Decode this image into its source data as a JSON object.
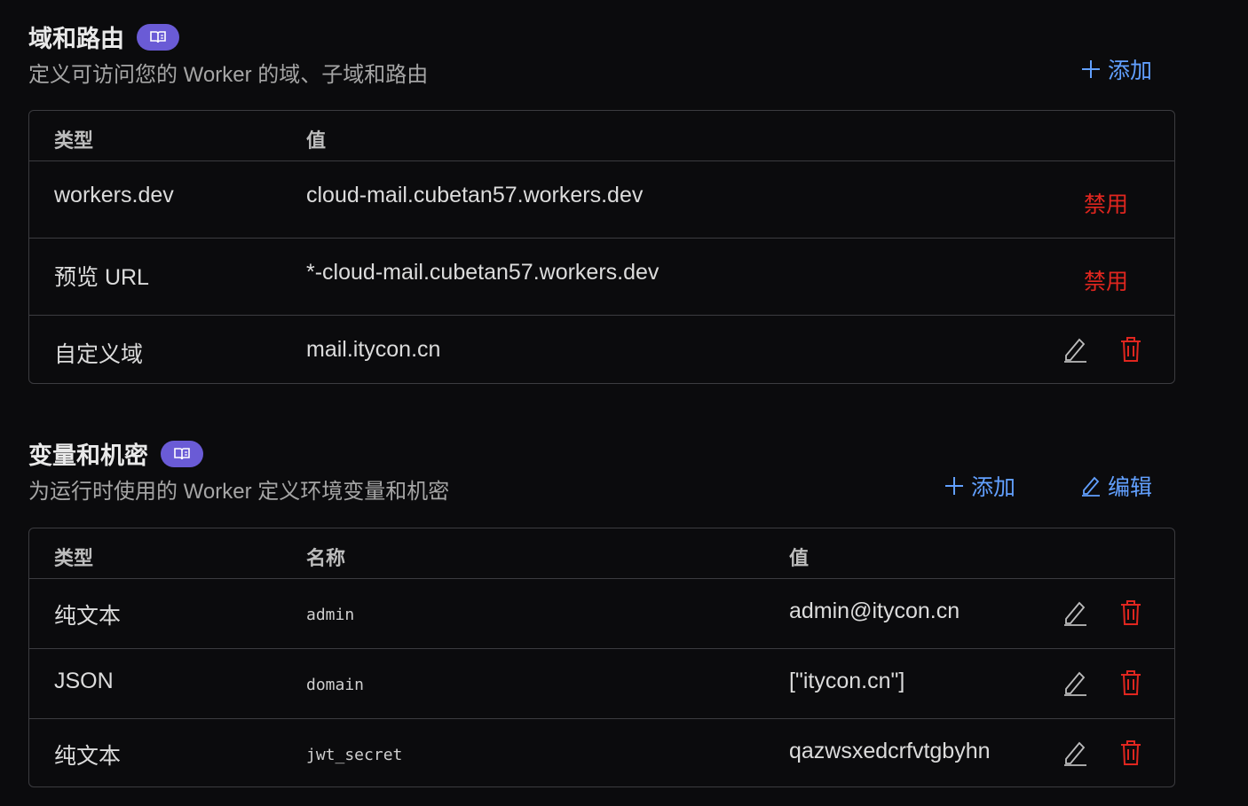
{
  "domains": {
    "title": "域和路由",
    "description": "定义可访问您的 Worker 的域、子域和路由",
    "add_label": "添加",
    "headers": {
      "type": "类型",
      "value": "值"
    },
    "rows": [
      {
        "type": "workers.dev",
        "value": "cloud-mail.cubetan57.workers.dev",
        "action": "禁用"
      },
      {
        "type": "预览 URL",
        "value": "*-cloud-mail.cubetan57.workers.dev",
        "action": "禁用"
      },
      {
        "type": "自定义域",
        "value": "mail.itycon.cn"
      }
    ]
  },
  "variables": {
    "title": "变量和机密",
    "description": "为运行时使用的 Worker 定义环境变量和机密",
    "add_label": "添加",
    "edit_label": "编辑",
    "headers": {
      "type": "类型",
      "name": "名称",
      "value": "值"
    },
    "rows": [
      {
        "type": "纯文本",
        "name": "admin",
        "value": "admin@itycon.cn"
      },
      {
        "type": "JSON",
        "name": "domain",
        "value": "[\"itycon.cn\"]"
      },
      {
        "type": "纯文本",
        "name": "jwt_secret",
        "value": "qazwsxedcrfvtgbyhn"
      }
    ]
  },
  "colors": {
    "accent": "#62a0ff",
    "danger": "#e0261f",
    "badge": "#6a5bd6",
    "background": "#0b0b0d",
    "border": "#3c3c40"
  },
  "icons": [
    "book-icon",
    "plus-icon",
    "pencil-icon",
    "trash-icon"
  ]
}
